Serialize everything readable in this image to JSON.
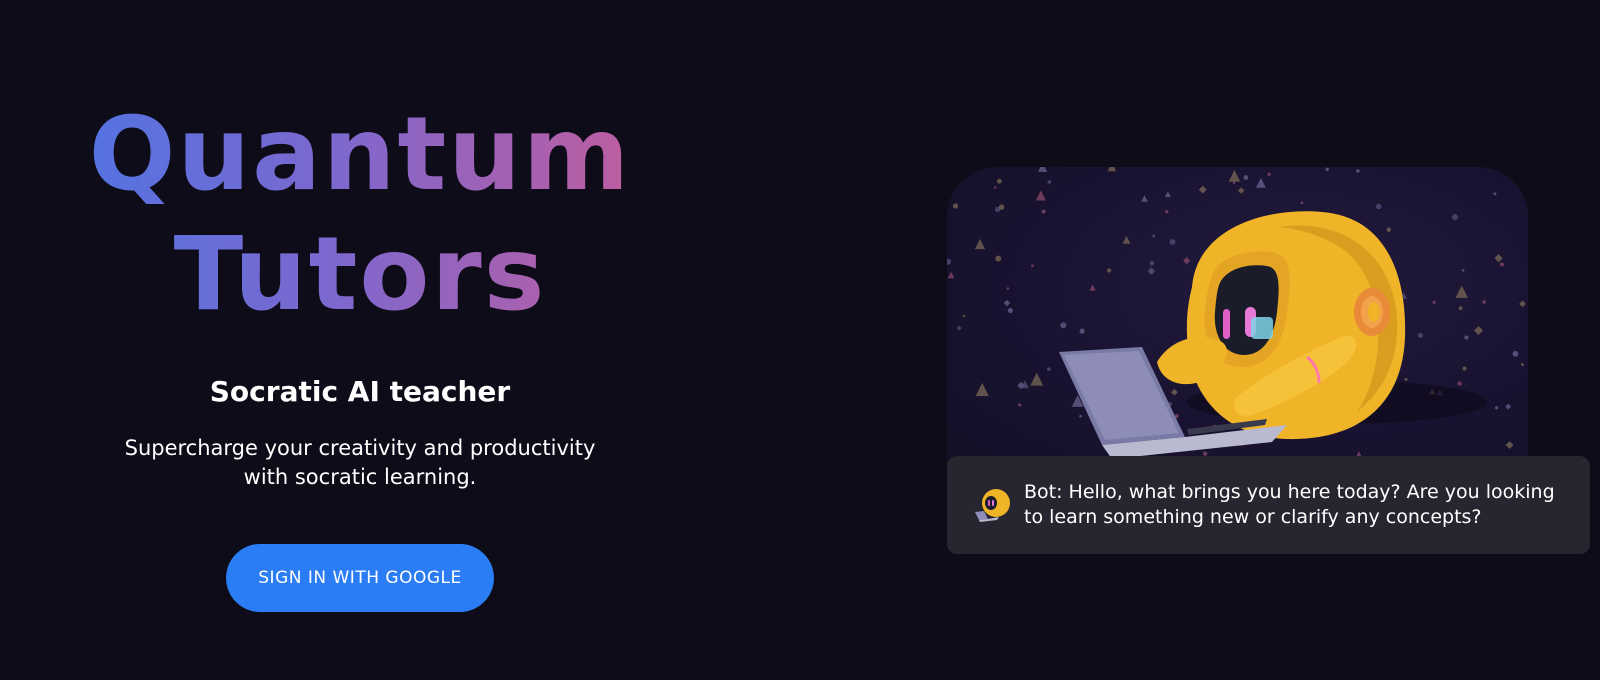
{
  "hero": {
    "title_line1": "Quantum",
    "title_line2": "Tutors",
    "subtitle": "Socratic AI teacher",
    "tagline": "Supercharge your creativity and productivity with socratic learning.",
    "signin_label": "SIGN IN WITH GOOGLE"
  },
  "chat": {
    "message": "Bot: Hello, what brings you here today? Are you looking to learn something new or clarify any concepts?"
  },
  "colors": {
    "background": "#0e0c18",
    "button": "#2a7df5",
    "gradient_start": "#4f74e3",
    "gradient_end": "#c45c9c",
    "chat_bubble": "#27252f",
    "robot": "#f0b428"
  },
  "icons": {
    "bot_avatar": "robot-avatar-icon",
    "illustration": "robot-with-laptop-illustration"
  }
}
